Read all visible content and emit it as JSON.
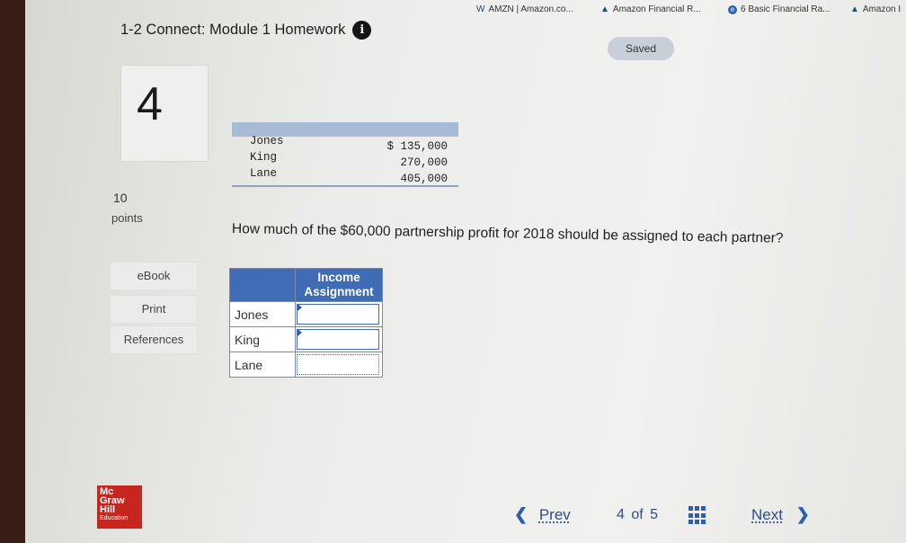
{
  "bookmarks": [
    {
      "label": "AMZN | Amazon.co...",
      "icon": "w-icon"
    },
    {
      "label": "Amazon Financial R...",
      "icon": "chart-icon"
    },
    {
      "label": "6 Basic Financial Ra...",
      "icon": "circle-icon"
    },
    {
      "label": "Amazon I",
      "icon": "chart-icon"
    }
  ],
  "header": {
    "title": "1-2 Connect: Module 1 Homework",
    "info_icon": "i",
    "saved_label": "Saved"
  },
  "question": {
    "number": "4",
    "points_value": "10",
    "points_label": "points",
    "prompt": "How much of the $60,000 partnership profit for 2018 should be assigned to each partner?"
  },
  "sidebar": {
    "ebook_label": "eBook",
    "print_label": "Print",
    "references_label": "References"
  },
  "reference_table": {
    "names": [
      "Jones",
      "King",
      "Lane"
    ],
    "values": [
      "$ 135,000",
      "270,000",
      "405,000"
    ]
  },
  "answer_table": {
    "header_line1": "Income",
    "header_line2": "Assignment",
    "rows": [
      {
        "name": "Jones",
        "value": ""
      },
      {
        "name": "King",
        "value": ""
      },
      {
        "name": "Lane",
        "value": ""
      }
    ]
  },
  "logo": {
    "line1": "Mc",
    "line2": "Graw",
    "line3": "Hill",
    "line4": "Education"
  },
  "navigation": {
    "prev_label": "Prev",
    "current_page": "4",
    "of_label": "of",
    "total_pages": "5",
    "next_label": "Next"
  },
  "colors": {
    "accent": "#3f6cb5",
    "logo_red": "#c7261e",
    "saved_badge": "#c9cfd8"
  }
}
